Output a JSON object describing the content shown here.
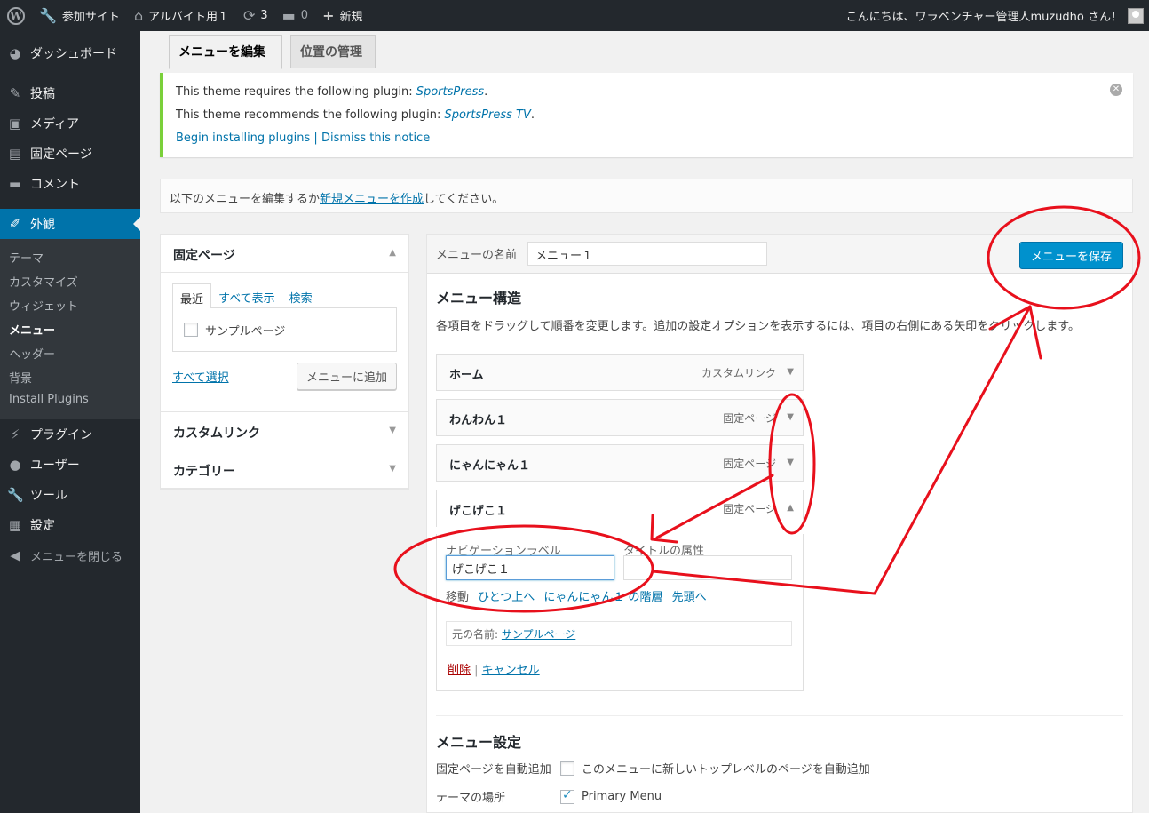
{
  "adminbar": {
    "site": "参加サイト",
    "site_name": "アルバイト用１",
    "updates": "3",
    "comments": "0",
    "new": "新規",
    "greeting": "こんにちは、ワラベンチャー管理人muzudho さん！"
  },
  "sidebar": {
    "dashboard": "ダッシュボード",
    "posts": "投稿",
    "media": "メディア",
    "pages": "固定ページ",
    "comments": "コメント",
    "appearance": "外観",
    "sub": [
      "テーマ",
      "カスタマイズ",
      "ウィジェット",
      "メニュー",
      "ヘッダー",
      "背景",
      "Install Plugins"
    ],
    "plugins": "プラグイン",
    "users": "ユーザー",
    "tools": "ツール",
    "settings": "設定",
    "collapse": "メニューを閉じる"
  },
  "tabs": {
    "edit": "メニューを編集",
    "locations": "位置の管理"
  },
  "notice": {
    "line1_prefix": "This theme requires the following plugin: ",
    "line1_link": "SportsPress",
    "line1_suffix": ".",
    "line2_prefix": "This theme recommends the following plugin: ",
    "line2_link": "SportsPress TV",
    "line2_suffix": ".",
    "install": "Begin installing plugins",
    "sep": "|",
    "dismiss": "Dismiss this notice"
  },
  "manage": {
    "prefix": "以下のメニューを編集するか",
    "link": "新規メニューを作成",
    "suffix": "してください。"
  },
  "accordion": {
    "pages_title": "固定ページ",
    "tab_recent": "最近",
    "tab_all": "すべて表示",
    "tab_search": "検索",
    "sample": "サンプルページ",
    "select_all": "すべて選択",
    "add_button": "メニューに追加",
    "custom_links": "カスタムリンク",
    "categories": "カテゴリー"
  },
  "menu": {
    "name_label": "メニューの名前",
    "name_value": "メニュー１",
    "save_button": "メニューを保存",
    "structure_title": "メニュー構造",
    "structure_desc": "各項目をドラッグして順番を変更します。追加の設定オプションを表示するには、項目の右側にある矢印をクリックします。",
    "items": [
      {
        "title": "ホーム",
        "type": "カスタムリンク"
      },
      {
        "title": "わんわん１",
        "type": "固定ページ"
      },
      {
        "title": "にゃんにゃん１",
        "type": "固定ページ"
      },
      {
        "title": "げこげこ１",
        "type": "固定ページ"
      }
    ],
    "nav_label": "ナビゲーションラベル",
    "title_attr": "タイトルの属性",
    "nav_value": "げこげこ１",
    "move_label": "移動",
    "move_up": "ひとつ上へ",
    "move_under": "にゃんにゃん１ の階層",
    "move_top": "先頭へ",
    "original_label": "元の名前:",
    "original_link": "サンプルページ",
    "delete": "削除",
    "cancel": "キャンセル",
    "settings_title": "メニュー設定",
    "auto_add_label": "固定ページを自動追加",
    "auto_add_text": "このメニューに新しいトップレベルのページを自動追加",
    "location_label": "テーマの場所",
    "location_value": "Primary Menu"
  },
  "colors": {
    "adminbar": "#23282d",
    "accent": "#0073aa",
    "annotation": "#e8101c"
  }
}
